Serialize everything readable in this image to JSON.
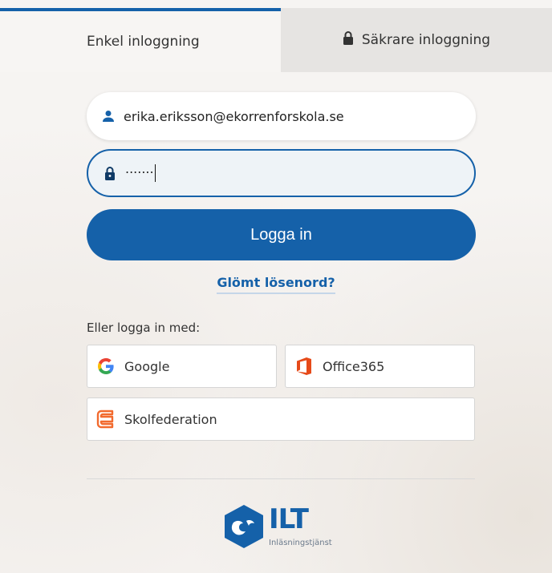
{
  "tabs": {
    "simple": "Enkel inloggning",
    "secure": "Säkrare inloggning"
  },
  "form": {
    "email_value": "erika.eriksson@ekorrenforskola.se",
    "password_masked": "·······",
    "login_label": "Logga in",
    "forgot_label": "Glömt lösenord?"
  },
  "alt_login": {
    "heading": "Eller logga in med:",
    "google": "Google",
    "office": "Office365",
    "skolfederation": "Skolfederation"
  },
  "brand": {
    "name": "ILT",
    "tagline": "Inläsningstjänst"
  },
  "colors": {
    "accent": "#1561a9",
    "office_orange": "#e64a19",
    "skol_orange": "#f26a2e"
  }
}
